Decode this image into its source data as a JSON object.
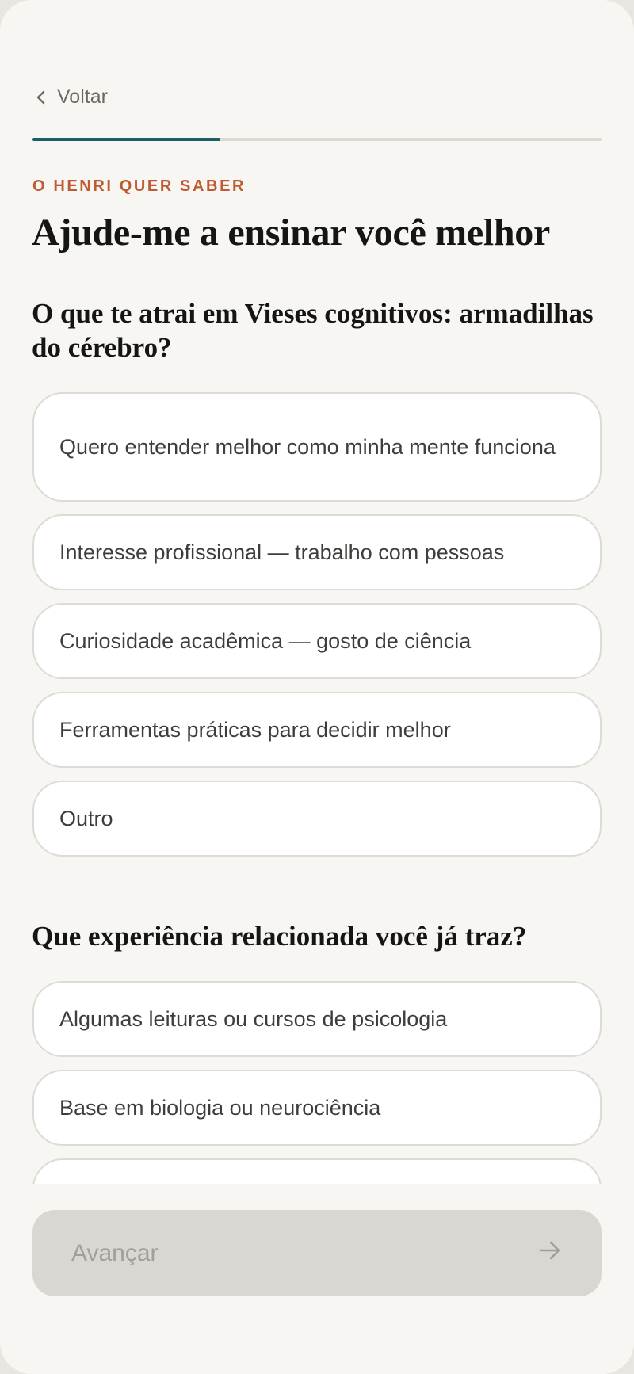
{
  "nav": {
    "back_label": "Voltar"
  },
  "progress": {
    "fraction": 0.33
  },
  "header": {
    "eyebrow": "O HENRI QUER SABER",
    "title": "Ajude-me a ensinar você melhor"
  },
  "questions": [
    {
      "prompt": "O que te atrai em Vieses cognitivos: armadilhas do cérebro?",
      "options": [
        "Quero entender melhor como minha mente funciona",
        "Interesse profissional — trabalho com pessoas",
        "Curiosidade acadêmica — gosto de ciência",
        "Ferramentas práticas para decidir melhor",
        "Outro"
      ]
    },
    {
      "prompt": "Que experiência relacionada você já traz?",
      "options": [
        "Algumas leituras ou cursos de psicologia",
        "Base em biologia ou neurociência",
        ""
      ]
    }
  ],
  "footer": {
    "next_label": "Avançar"
  },
  "colors": {
    "accent": "#1b5e63",
    "eyebrow": "#bf5b33",
    "background": "#f8f6f3",
    "disabled_button": "#dad7d2"
  }
}
